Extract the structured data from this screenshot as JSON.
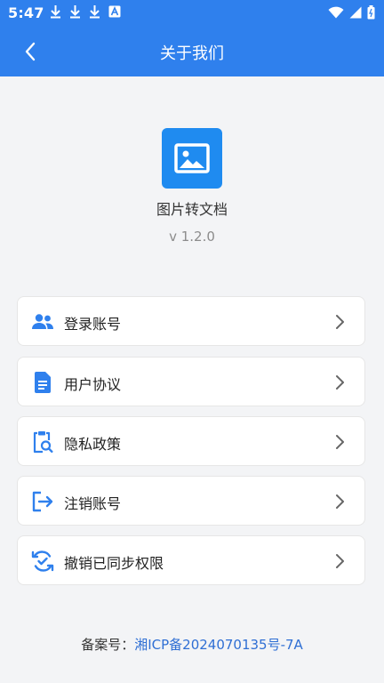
{
  "status_bar": {
    "time": "5:47",
    "left_icons": [
      "download-icon",
      "download-icon",
      "download-icon",
      "a-icon"
    ],
    "right_icons": [
      "wifi-icon",
      "signal-icon",
      "battery-icon"
    ]
  },
  "header": {
    "title": "关于我们",
    "back_icon": "chevron-left-icon",
    "background": "#2F80ED"
  },
  "app": {
    "logo_icon": "image-icon",
    "name": "图片转文档",
    "version": "v 1.2.0"
  },
  "menu": {
    "items": [
      {
        "label": "登录账号",
        "icon": "users-icon"
      },
      {
        "label": "用户协议",
        "icon": "document-icon"
      },
      {
        "label": "隐私政策",
        "icon": "clipboard-search-icon"
      },
      {
        "label": "注销账号",
        "icon": "logout-icon"
      },
      {
        "label": "撤销已同步权限",
        "icon": "sync-check-icon"
      }
    ],
    "accent": "#2F80ED"
  },
  "footer": {
    "label": "备案号：",
    "link": "湘ICP备2024070135号-7A"
  }
}
